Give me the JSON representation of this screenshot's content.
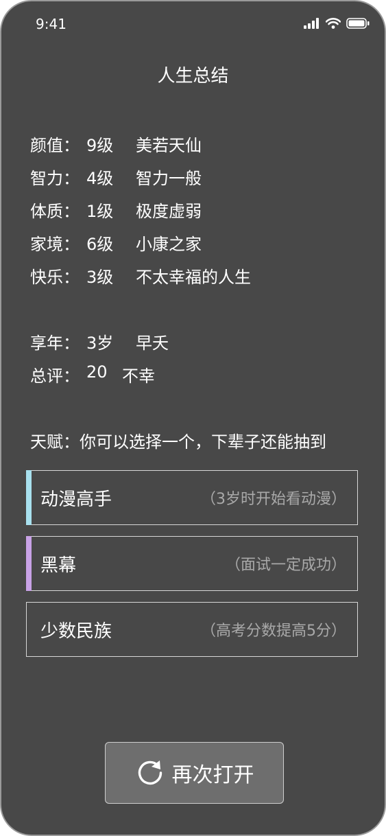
{
  "status_bar": {
    "time": "9:41"
  },
  "title": "人生总结",
  "attributes": [
    {
      "key": "颜值：",
      "level": "9级",
      "desc": "美若天仙"
    },
    {
      "key": "智力：",
      "level": "4级",
      "desc": "智力一般"
    },
    {
      "key": "体质：",
      "level": "1级",
      "desc": "极度虚弱"
    },
    {
      "key": "家境：",
      "level": "6级",
      "desc": "小康之家"
    },
    {
      "key": "快乐：",
      "level": "3级",
      "desc": "不太幸福的人生"
    }
  ],
  "lifespan": {
    "key": "享年：",
    "value": "3岁",
    "desc": "早夭"
  },
  "rating": {
    "key": "总评：",
    "value": "20",
    "desc": "不幸"
  },
  "talent_prompt": "天赋：你可以选择一个，下辈子还能抽到",
  "talents": [
    {
      "name": "动漫高手",
      "desc": "（3岁时开始看动漫）",
      "accent": "#a8e0ee"
    },
    {
      "name": "黑幕",
      "desc": "（面试一定成功）",
      "accent": "#c8a2e6"
    },
    {
      "name": "少数民族",
      "desc": "（高考分数提高5分）",
      "accent": ""
    }
  ],
  "restart_button": {
    "label": "再次打开",
    "icon": "refresh-icon"
  }
}
